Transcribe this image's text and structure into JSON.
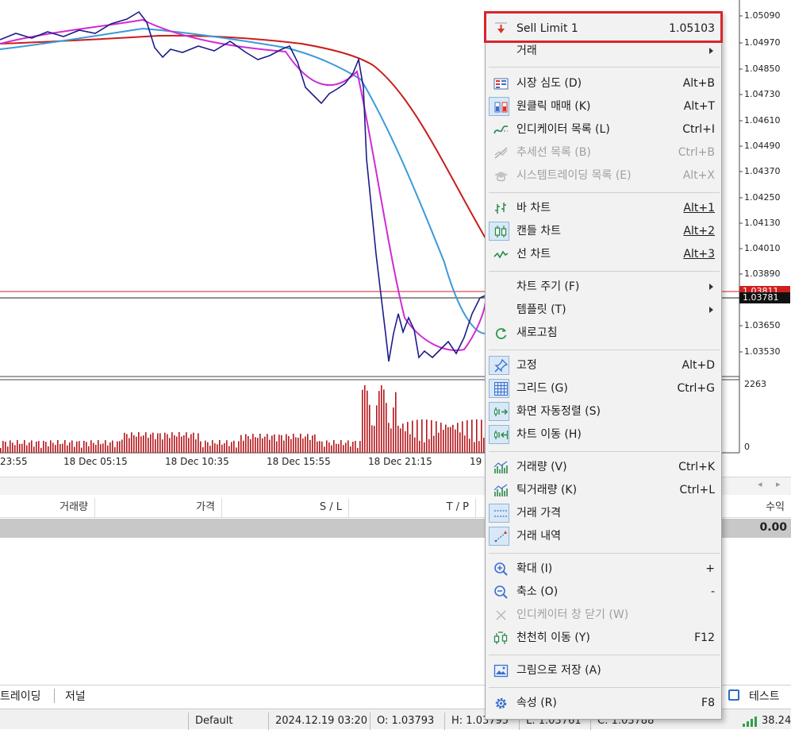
{
  "chart": {
    "price_axis": [
      "1.05090",
      "1.04970",
      "1.04850",
      "1.04730",
      "1.04610",
      "1.04490",
      "1.04370",
      "1.04250",
      "1.04130",
      "1.04010",
      "1.03890",
      "1.03650",
      "1.03530"
    ],
    "price_tag_red": "1.03811",
    "price_tag_current": "1.03781",
    "volume_max": "2263",
    "volume_min": "0",
    "time_axis": [
      "23:55",
      "18 Dec 05:15",
      "18 Dec 10:35",
      "18 Dec 15:55",
      "18 Dec 21:15",
      "19"
    ]
  },
  "toolbox": {
    "columns": [
      "거래량",
      "가격",
      "S / L",
      "T / P",
      "수익"
    ],
    "total_profit": "0.00",
    "tabs": [
      "트레이딩",
      "저널"
    ],
    "right_tab": "테스트"
  },
  "status_bar": {
    "profile": "Default",
    "datetime": "2024.12.19 03:20",
    "open": "O: 1.03793",
    "high": "H: 1.03795",
    "low": "L: 1.03761",
    "close": "C: 1.03788",
    "signal": "38.24"
  },
  "context_menu": {
    "items": [
      {
        "label": "Sell Limit 1",
        "shortcut": "1.05103",
        "icon": "sell-limit-icon"
      },
      {
        "label": "거래",
        "shortcut": "",
        "icon": "",
        "submenu": true
      },
      {
        "label": "시장 심도 (D)",
        "shortcut": "Alt+B",
        "icon": "market-depth-icon"
      },
      {
        "label": "원클릭 매매 (K)",
        "shortcut": "Alt+T",
        "icon": "one-click-trading-icon"
      },
      {
        "label": "인디케이터 목록 (L)",
        "shortcut": "Ctrl+I",
        "icon": "indicator-list-icon"
      },
      {
        "label": "추세선 목록 (B)",
        "shortcut": "Ctrl+B",
        "icon": "trendline-list-icon",
        "disabled": true
      },
      {
        "label": "시스템트레이딩 목록 (E)",
        "shortcut": "Alt+X",
        "icon": "expert-list-icon",
        "disabled": true
      },
      {
        "label": "바 차트",
        "shortcut": "Alt+1",
        "icon": "bar-chart-icon"
      },
      {
        "label": "캔들 차트",
        "shortcut": "Alt+2",
        "icon": "candle-chart-icon"
      },
      {
        "label": "선 차트",
        "shortcut": "Alt+3",
        "icon": "line-chart-icon"
      },
      {
        "label": "차트 주기 (F)",
        "shortcut": "",
        "icon": "",
        "submenu": true
      },
      {
        "label": "템플릿 (T)",
        "shortcut": "",
        "icon": "",
        "submenu": true
      },
      {
        "label": "새로고침",
        "shortcut": "",
        "icon": "refresh-icon"
      },
      {
        "label": "고정",
        "shortcut": "Alt+D",
        "icon": "pin-icon"
      },
      {
        "label": "그리드 (G)",
        "shortcut": "Ctrl+G",
        "icon": "grid-icon"
      },
      {
        "label": "화면 자동정렬 (S)",
        "shortcut": "",
        "icon": "auto-scroll-icon"
      },
      {
        "label": "차트 이동 (H)",
        "shortcut": "",
        "icon": "chart-shift-icon"
      },
      {
        "label": "거래량 (V)",
        "shortcut": "Ctrl+K",
        "icon": "volume-icon"
      },
      {
        "label": "틱거래량 (K)",
        "shortcut": "Ctrl+L",
        "icon": "tick-volume-icon"
      },
      {
        "label": "거래 가격",
        "shortcut": "",
        "icon": "trade-price-icon"
      },
      {
        "label": "거래 내역",
        "shortcut": "",
        "icon": "trade-history-icon"
      },
      {
        "label": "확대 (I)",
        "shortcut": "+",
        "icon": "zoom-in-icon"
      },
      {
        "label": "축소 (O)",
        "shortcut": "-",
        "icon": "zoom-out-icon"
      },
      {
        "label": "인디케이터 창 닫기 (W)",
        "shortcut": "",
        "icon": "close-icon",
        "disabled": true
      },
      {
        "label": "천천히 이동 (Y)",
        "shortcut": "F12",
        "icon": "step-scroll-icon"
      },
      {
        "label": "그림으로 저장 (A)",
        "shortcut": "",
        "icon": "save-picture-icon"
      },
      {
        "label": "속성 (R)",
        "shortcut": "F8",
        "icon": "gear-icon"
      }
    ]
  },
  "colors": {
    "highlight_border": "#d8252d",
    "price_line": "#1c1c8a",
    "ma_fast": "#d22bd2",
    "ma_mid": "#3a9ad8",
    "ma_slow": "#c81e1e",
    "volume_bars": "#b5161b"
  }
}
